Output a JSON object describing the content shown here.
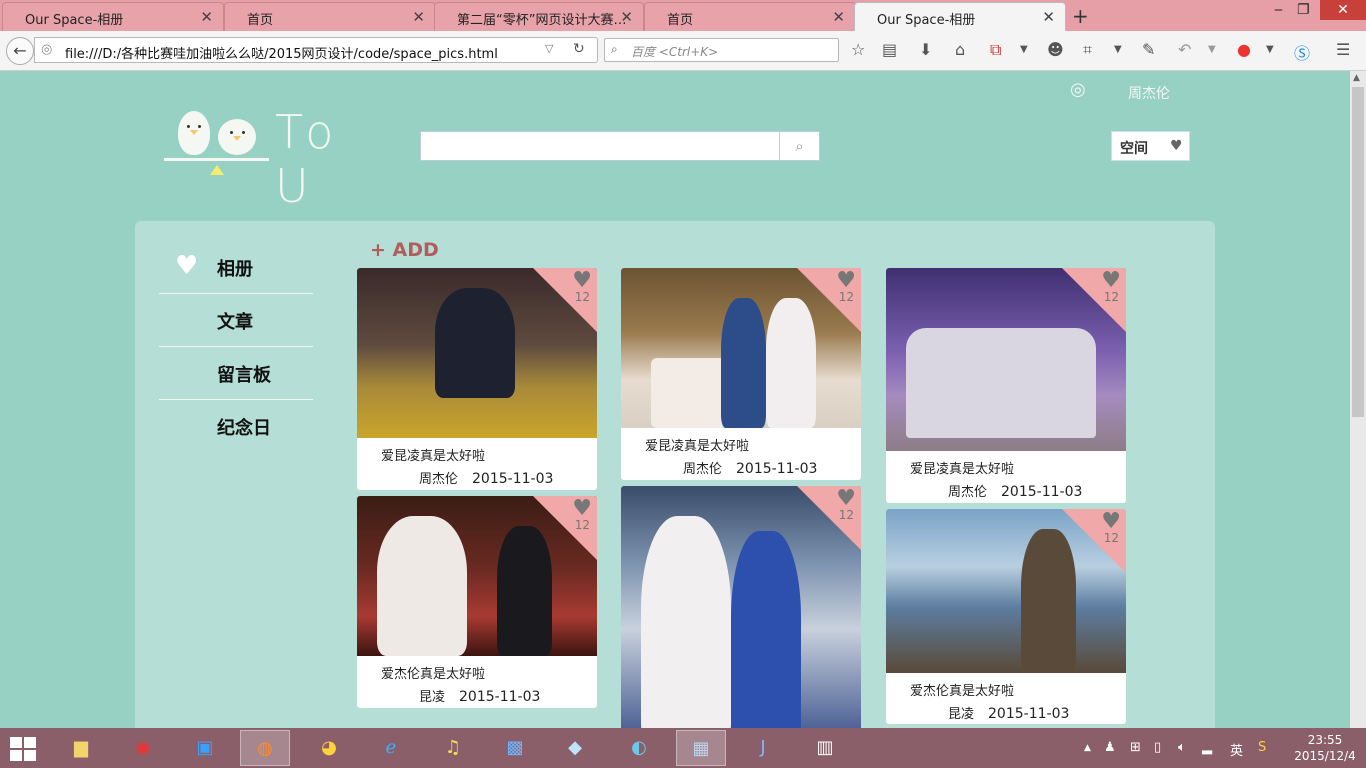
{
  "browser": {
    "tabs": [
      {
        "title": "Our Space-相册",
        "active": false
      },
      {
        "title": "首页",
        "active": false
      },
      {
        "title": "第二届“零杯”网页设计大赛 - ...",
        "active": false
      },
      {
        "title": "首页",
        "active": false
      },
      {
        "title": "Our Space-相册",
        "active": true
      }
    ],
    "url": "file:///D:/各种比赛哇加油啦么么哒/2015网页设计/code/space_pics.html",
    "search_placeholder": "百度 <Ctrl+K>"
  },
  "header": {
    "logo_text": "To U",
    "search_value": "",
    "username": "周杰伦",
    "space_label": "空间"
  },
  "sidebar": {
    "items": [
      {
        "label": "相册",
        "active": true
      },
      {
        "label": "文章"
      },
      {
        "label": "留言板"
      },
      {
        "label": "纪念日"
      }
    ]
  },
  "add_label": "+ ADD",
  "cards": [
    {
      "caption": "爱昆凌真是太好啦",
      "author": "周杰伦",
      "date": "2015-11-03",
      "likes": "12"
    },
    {
      "caption": "爱昆凌真是太好啦",
      "author": "周杰伦",
      "date": "2015-11-03",
      "likes": "12"
    },
    {
      "caption": "爱昆凌真是太好啦",
      "author": "周杰伦",
      "date": "2015-11-03",
      "likes": "12"
    },
    {
      "caption": "爱杰伦真是太好啦",
      "author": "昆凌",
      "date": "2015-11-03",
      "likes": "12"
    },
    {
      "caption": "",
      "author": "",
      "date": "",
      "likes": "12"
    },
    {
      "caption": "爱杰伦真是太好啦",
      "author": "昆凌",
      "date": "2015-11-03",
      "likes": "12"
    }
  ],
  "taskbar": {
    "time": "23:55",
    "date": "2015/12/4",
    "ime": "英",
    "apps": [
      "file-explorer",
      "music-player",
      "download-manager",
      "firefox",
      "chrome",
      "internet-explorer",
      "qq-music",
      "photoshop",
      "note-app",
      "app-blue",
      "photo-viewer",
      "ji-app",
      "mle-app"
    ]
  },
  "colors": {
    "page_bg": "#96d1c3",
    "panel_bg": "#b5dfd6",
    "tabbar_bg": "#e69fa6",
    "accent": "#b25d5d",
    "corner": "#f0a8a8"
  }
}
